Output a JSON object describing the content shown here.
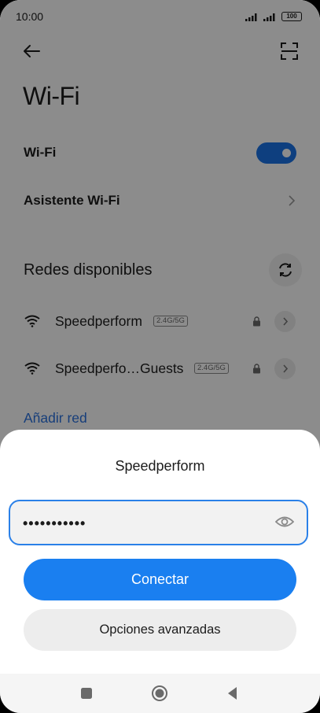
{
  "status_bar": {
    "time": "10:00",
    "battery": "100"
  },
  "page": {
    "title": "Wi-Fi"
  },
  "rows": {
    "wifi_label": "Wi-Fi",
    "wifi_enabled": true,
    "assistant_label": "Asistente Wi-Fi"
  },
  "networks_section": {
    "label": "Redes disponibles",
    "networks": [
      {
        "name": "Speedperform",
        "band": "2.4G/5G",
        "secured": true
      },
      {
        "name": "Speedperfo…Guests",
        "band": "2.4G/5G",
        "secured": true
      }
    ],
    "add_network": "Añadir red"
  },
  "dialog": {
    "title": "Speedperform",
    "password_value": "•••••••••••",
    "connect_label": "Conectar",
    "advanced_label": "Opciones avanzadas"
  },
  "icons": {
    "back": "back-arrow-icon",
    "scan": "scan-qr-icon",
    "refresh": "refresh-icon",
    "wifi": "wifi-signal-icon",
    "lock": "lock-icon",
    "chevron": "chevron-right-icon",
    "eye": "eye-icon",
    "nav_recent": "recent-apps-icon",
    "nav_home": "home-icon",
    "nav_back": "nav-back-icon"
  },
  "colors": {
    "accent": "#1a7ff0",
    "link": "#2a72de",
    "toggle_on": "#1a73e8"
  }
}
